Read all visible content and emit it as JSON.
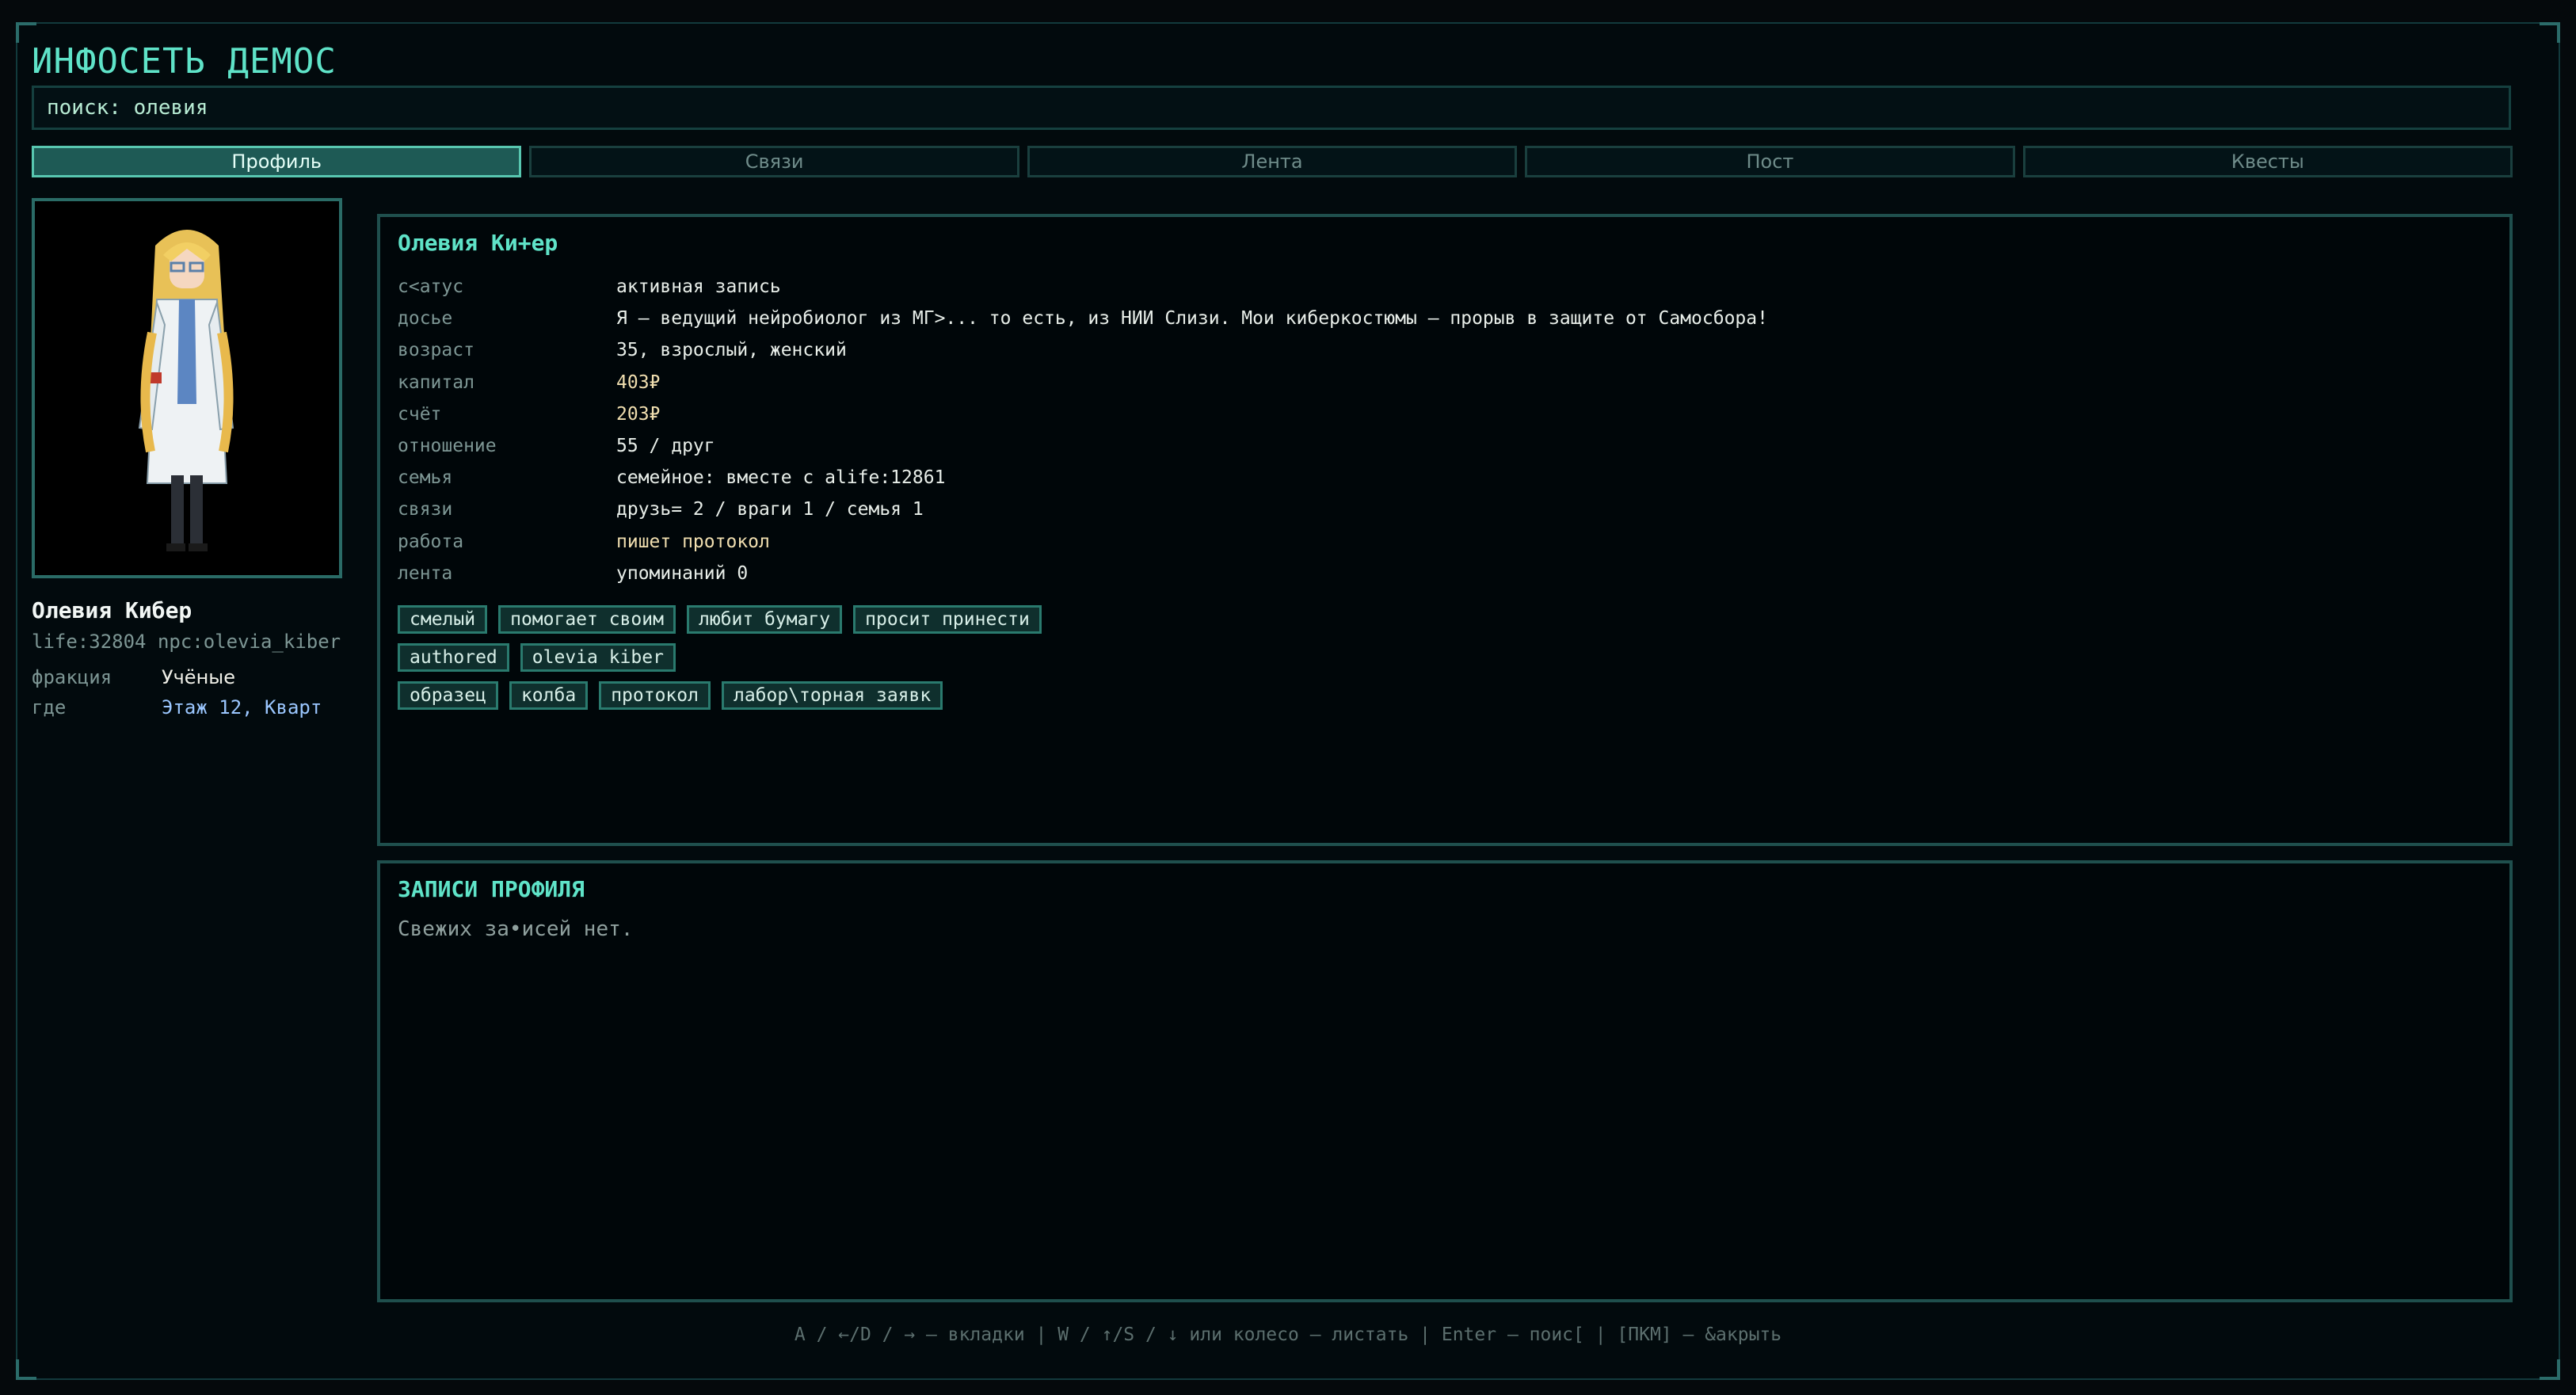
{
  "app": {
    "title": "ИНФОСЕТЬ ДЕМОС"
  },
  "search": {
    "text": "поиск: олевия"
  },
  "tabs": [
    {
      "label": "Профиль",
      "active": true
    },
    {
      "label": "Связи",
      "active": false
    },
    {
      "label": "Лента",
      "active": false
    },
    {
      "label": "Пост",
      "active": false
    },
    {
      "label": "Квесты",
      "active": false
    }
  ],
  "character": {
    "name": "Олевия Кибер",
    "id_line": "life:32804 npc:olevia_kiber",
    "meta": [
      {
        "key": "фракция",
        "value": "Учёные"
      },
      {
        "key": "где",
        "value": "Этаж 12, Кварт"
      }
    ]
  },
  "profile": {
    "title": "Олевия Ки+ер",
    "fields": [
      {
        "key": "с<атус",
        "value": "активная запись"
      },
      {
        "key": "досье",
        "value": "Я — ведущий нейробиолог из МГ>... то есть, из НИИ Слизи. Мои киберкостюмы — прорыв в защите от Самосбора!"
      },
      {
        "key": "возраст",
        "value": "35, взрослый, женский"
      },
      {
        "key": "капитал",
        "value": "403₽"
      },
      {
        "key": "счёт",
        "value": "203₽"
      },
      {
        "key": "отношение",
        "value": "55 / друг"
      },
      {
        "key": "семья",
        "value": "семейное: вместе с alife:12861"
      },
      {
        "key": "связи",
        "value": "друзь= 2 / враги 1 / семья 1"
      },
      {
        "key": "работа",
        "value": "пишет протокол"
      },
      {
        "key": "лента",
        "value": "упоминаний 0"
      }
    ],
    "tag_rows": [
      [
        "смелый",
        "помогает своим",
        "любит бумагу",
        "просит принести"
      ],
      [
        "authored",
        "olevia kiber"
      ],
      [
        "образец",
        "колба",
        "протокол",
        "лабор\\торная заявк"
      ]
    ]
  },
  "records": {
    "title": "ЗАПИСИ ПРОФИЛЯ",
    "empty": "Свежих за•исей нет."
  },
  "footer": {
    "hint": "A / ←/D / → — вкладки  |  W / ↑/S / ↓ или колесо — листать  |  Enter — поис[  |  [ПКМ] — &акрыть"
  },
  "colors": {
    "accent": "#5fe3c8",
    "tab_active_bg": "#1e5a55",
    "border": "#1f4f4d",
    "background": "#020a0d"
  }
}
